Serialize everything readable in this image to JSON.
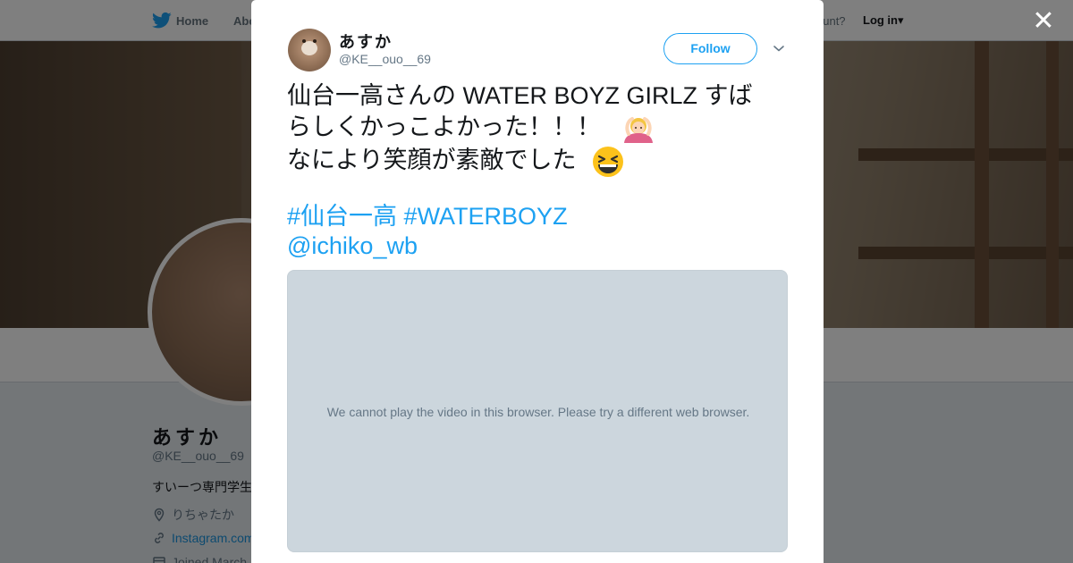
{
  "topbar": {
    "home_label": "Home",
    "about_label": "Abo",
    "account_prompt": "ccount?",
    "login_label": "Log in",
    "login_caret": "▾"
  },
  "profile": {
    "name": "あすか",
    "handle": "@KE__ouo__69",
    "bio": "すいーつ専門学生",
    "location": "りちゃたか",
    "website": "Instagram.com",
    "joined": "Joined March"
  },
  "modal": {
    "close_glyph": "✕",
    "author_name": "あすか",
    "author_handle": "@KE__ouo__69",
    "follow_label": "Follow",
    "tweet_line1": "仙台一高さんの WATER BOYZ GIRLZ すば",
    "tweet_line2": "らしくかっこよかった！！！",
    "tweet_line3": "なにより笑顔が素敵でした",
    "hashtag1": "#仙台一高",
    "hashtag2": "#WATERBOYZ",
    "mention": "@ichiko_wb",
    "video_message": "We cannot play the video in this browser. Please try a different web browser."
  },
  "icons": {
    "logo": "twitter-bird-icon",
    "close": "close-icon",
    "chevron": "chevron-down-icon",
    "emoji1": "person-gesturing-ok-emoji",
    "emoji2": "grinning-squinting-face-emoji",
    "location": "location-pin-icon",
    "link": "link-icon",
    "calendar": "calendar-icon"
  },
  "colors": {
    "accent": "#1da1f2",
    "text": "#14171a",
    "muted": "#657786",
    "video_bg": "#ccd6dd"
  }
}
